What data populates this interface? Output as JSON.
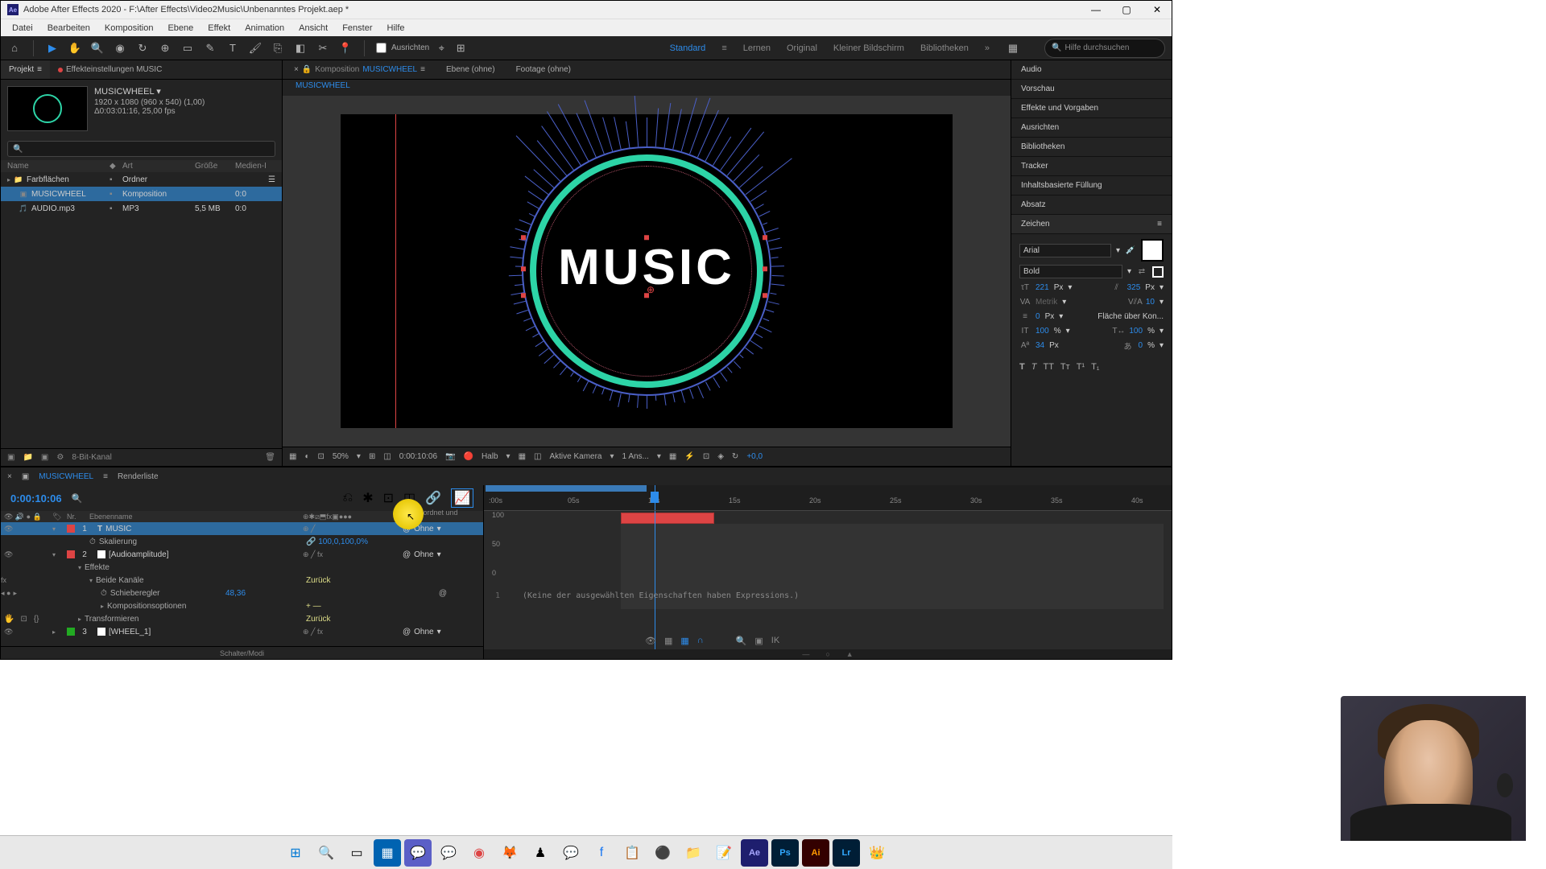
{
  "title": "Adobe After Effects 2020 - F:\\After Effects\\Video2Music\\Unbenanntes Projekt.aep *",
  "menu": [
    "Datei",
    "Bearbeiten",
    "Komposition",
    "Ebene",
    "Effekt",
    "Animation",
    "Ansicht",
    "Fenster",
    "Hilfe"
  ],
  "toolbar": {
    "ausrichten": "Ausrichten",
    "workspaces": [
      "Standard",
      "Lernen",
      "Original",
      "Kleiner Bildschirm",
      "Bibliotheken"
    ],
    "search_placeholder": "Hilfe durchsuchen"
  },
  "project_panel": {
    "tab1": "Projekt",
    "tab2": "Effekteinstellungen MUSIC",
    "comp_name": "MUSICWHEEL",
    "dims": "1920 x 1080 (960 x 540) (1,00)",
    "duration": "Δ0:03:01:16, 25,00 fps",
    "headers": {
      "name": "Name",
      "art": "Art",
      "groesse": "Größe",
      "medien": "Medien-I"
    },
    "rows": [
      {
        "name": "Farbflächen",
        "art": "Ordner",
        "groesse": "",
        "medien": ""
      },
      {
        "name": "MUSICWHEEL",
        "art": "Komposition",
        "groesse": "",
        "medien": "0:0"
      },
      {
        "name": "AUDIO.mp3",
        "art": "MP3",
        "groesse": "5,5 MB",
        "medien": "0:0"
      }
    ],
    "bit_depth": "8-Bit-Kanal"
  },
  "comp_viewer": {
    "tab_label": "Komposition",
    "tab_value": "MUSICWHEEL",
    "tab2": "Ebene (ohne)",
    "tab3": "Footage (ohne)",
    "breadcrumb": "MUSICWHEEL",
    "music_text": "MUSIC",
    "zoom": "50%",
    "timecode": "0:00:10:06",
    "quality": "Halb",
    "camera": "Aktive Kamera",
    "views": "1 Ans...",
    "exposure": "+0,0"
  },
  "right_panel": {
    "items": [
      "Audio",
      "Vorschau",
      "Effekte und Vorgaben",
      "Ausrichten",
      "Bibliotheken",
      "Tracker",
      "Inhaltsbasierte Füllung",
      "Absatz",
      "Zeichen"
    ],
    "char": {
      "font": "Arial",
      "weight": "Bold",
      "size": "221",
      "size_unit": "Px",
      "leading": "325",
      "kerning": "Metrik",
      "tracking": "10",
      "stroke": "0",
      "stroke_unit": "Px",
      "stroke_mode": "Fläche über Kon...",
      "hscale": "100",
      "vscale": "100",
      "baseline": "34",
      "tsume": "0",
      "pct": "%"
    }
  },
  "timeline": {
    "tab": "MUSICWHEEL",
    "tab2": "Renderliste",
    "timecode": "0:00:10:06",
    "header_nr": "Nr.",
    "header_name": "Ebenenname",
    "header_parent": "Übergeordnet und verkn...",
    "parent_none": "Ohne",
    "layers": [
      {
        "nr": "1",
        "name": "MUSIC",
        "type": "T"
      },
      {
        "nr": "2",
        "name": "[Audioamplitude]",
        "type": "solid"
      },
      {
        "nr": "3",
        "name": "[WHEEL_1]",
        "type": "comp"
      }
    ],
    "props": {
      "skalierung": "Skalierung",
      "skalierung_val": "100,0,100,0",
      "skalierung_unit": "%",
      "effekte": "Effekte",
      "beide": "Beide Kanäle",
      "zurueck": "Zurück",
      "schieberegler": "Schieberegler",
      "schieb_val": "48,36",
      "komp_opt": "Kompositionsoptionen",
      "transformieren": "Transformieren"
    },
    "ruler": [
      ":00s",
      "05s",
      "10s",
      "15s",
      "20s",
      "25s",
      "30s",
      "35s",
      "40s"
    ],
    "graph_y": [
      "100",
      "50",
      "0"
    ],
    "expr_line": "1",
    "expr_text": "(Keine der ausgewählten Eigenschaften haben Expressions.)",
    "footer": "Schalter/Modi"
  },
  "taskbar": {
    "ae": "Ae",
    "ps": "Ps",
    "ai": "Ai",
    "lr": "Lr"
  }
}
